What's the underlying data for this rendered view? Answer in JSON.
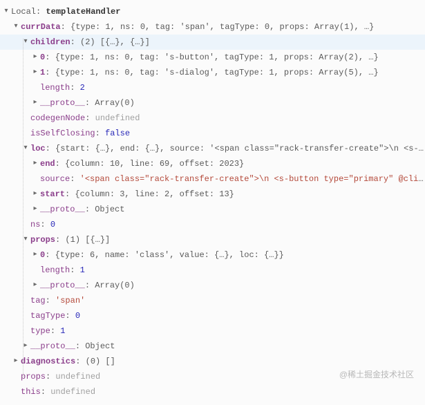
{
  "header": {
    "scope": "Local: ",
    "name": "templateHandler"
  },
  "rows": {
    "currData": {
      "key": "currData",
      "val": "{type: 1, ns: 0, tag: 'span', tagType: 0, props: Array(1), …}"
    },
    "children": {
      "key": "children",
      "val": "(2) [{…}, {…}]"
    },
    "child0": {
      "key": "0",
      "val": "{type: 1, ns: 0, tag: 's-button', tagType: 1, props: Array(2), …}"
    },
    "child1": {
      "key": "1",
      "val": "{type: 1, ns: 0, tag: 's-dialog', tagType: 1, props: Array(5), …}"
    },
    "childrenLen": {
      "key": "length",
      "val": "2"
    },
    "childrenProto": {
      "key": "__proto__",
      "val": "Array(0)"
    },
    "codegen": {
      "key": "codegenNode",
      "val": "undefined"
    },
    "isSelf": {
      "key": "isSelfClosing",
      "val": "false"
    },
    "loc": {
      "key": "loc",
      "val": "{start: {…}, end: {…}, source: '<span class=\"rack-transfer-create\">\\n    <s-bu……"
    },
    "locEnd": {
      "key": "end",
      "val": "{column: 10, line: 69, offset: 2023}"
    },
    "locSource": {
      "key": "source",
      "val": "'<span class=\"rack-transfer-create\">\\n    <s-button type=\"primary\" @click=\"…"
    },
    "locStart": {
      "key": "start",
      "val": "{column: 3, line: 2, offset: 13}"
    },
    "locProto": {
      "key": "__proto__",
      "val": "Object"
    },
    "ns": {
      "key": "ns",
      "val": "0"
    },
    "props": {
      "key": "props",
      "val": "(1) [{…}]"
    },
    "props0": {
      "key": "0",
      "val": "{type: 6, name: 'class', value: {…}, loc: {…}}"
    },
    "propsLen": {
      "key": "length",
      "val": "1"
    },
    "propsProto": {
      "key": "__proto__",
      "val": "Array(0)"
    },
    "tag": {
      "key": "tag",
      "val": "'span'"
    },
    "tagType": {
      "key": "tagType",
      "val": "0"
    },
    "type": {
      "key": "type",
      "val": "1"
    },
    "protoRoot": {
      "key": "__proto__",
      "val": "Object"
    },
    "diag": {
      "key": "diagnostics",
      "val": "(0) []"
    },
    "pProps": {
      "key": "props",
      "val": "undefined"
    },
    "pThis": {
      "key": "this",
      "val": "undefined"
    }
  },
  "watermark": "@稀土掘金技术社区"
}
